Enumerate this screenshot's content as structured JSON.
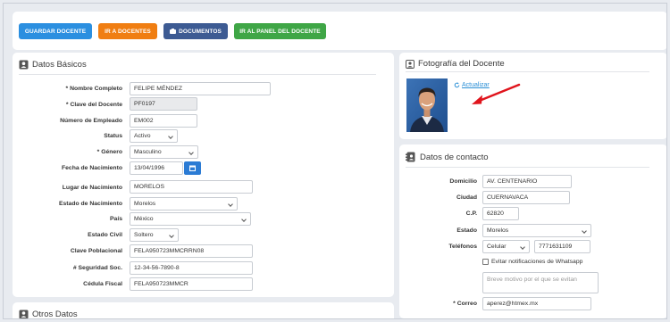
{
  "toolbar": {
    "save_label": "GUARDAR DOCENTE",
    "back_label": "IR A DOCENTES",
    "documents_label": "DOCUMENTOS",
    "panel_label": "IR AL PANEL DEL DOCENTE",
    "colors": {
      "save": "#2b8fe0",
      "back": "#f07e12",
      "documents": "#3d5b93",
      "panel": "#3fa646"
    }
  },
  "basic": {
    "title": "Datos Básicos",
    "nombre_label": "* Nombre Completo",
    "nombre_value": "FELIPE MÉNDEZ",
    "clave_label": "* Clave del Docente",
    "clave_value": "PF0197",
    "empleado_label": "Número de Empleado",
    "empleado_value": "EM002",
    "status_label": "Status",
    "status_value": "Activo",
    "genero_label": "* Género",
    "genero_value": "Masculino",
    "fecha_label": "Fecha de Nacimiento",
    "fecha_value": "13/04/1996",
    "lugar_label": "Lugar de Nacimiento",
    "lugar_value": "MORELOS",
    "estado_nac_label": "Estado de Nacimiento",
    "estado_nac_value": "Morelos",
    "pais_label": "País",
    "pais_value": "México",
    "civil_label": "Estado Civil",
    "civil_value": "Soltero",
    "curp_label": "Clave Poblacional",
    "curp_value": "FELA950723MMCRRN08",
    "nss_label": "# Seguridad Soc.",
    "nss_value": "12-34-56-7890-8",
    "rfc_label": "Cédula Fiscal",
    "rfc_value": "FELA950723MMCR"
  },
  "photo": {
    "title": "Fotografía del Docente",
    "update_label": "Actualizar"
  },
  "contact": {
    "title": "Datos de contacto",
    "domicilio_label": "Domicilio",
    "domicilio_value": "AV. CENTENARIO",
    "ciudad_label": "Ciudad",
    "ciudad_value": "CUERNAVACA",
    "cp_label": "C.P.",
    "cp_value": "62820",
    "estado_label": "Estado",
    "estado_value": "Morelos",
    "tel_label": "Teléfonos",
    "tel_type": "Celular",
    "tel_value": "7771631109",
    "whatsapp_label": "Evitar notificaciones de Whatsapp",
    "reason_placeholder": "Breve motivo por el que se evitan",
    "correo_label": "* Correo",
    "correo_value": "aperez@htmex.mx"
  },
  "other": {
    "title": "Otros Datos"
  },
  "icons": [
    "save-icon",
    "documents-icon",
    "address-card-icon",
    "camera-icon",
    "refresh-icon",
    "calendar-icon",
    "contact-book-icon",
    "user-icon"
  ]
}
